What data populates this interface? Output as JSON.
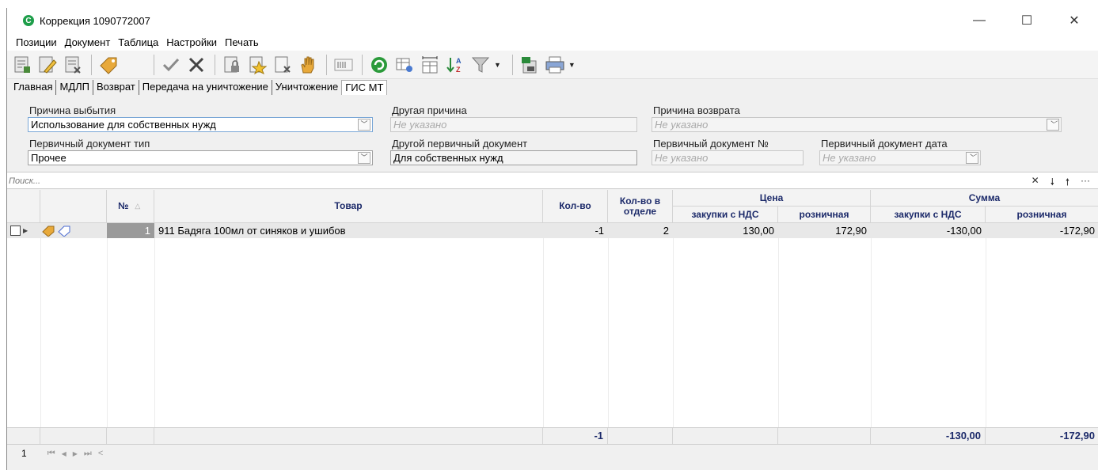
{
  "window": {
    "title": "Коррекция 1090772007",
    "icon_letter": "C",
    "controls": {
      "minimize": "—",
      "maximize": "☐",
      "close": "✕"
    }
  },
  "menu": [
    "Позиции",
    "Документ",
    "Таблица",
    "Настройки",
    "Печать"
  ],
  "toolbar": {
    "icons": [
      "add-row-icon",
      "edit-icon",
      "delete-row-icon",
      "tag-icon",
      "check-icon",
      "cancel-icon",
      "lock-doc-icon",
      "stamp-doc-icon",
      "doc-delete-icon",
      "stop-hand-icon",
      "barcode-icon",
      "refresh-icon",
      "table-settings-icon",
      "column-width-icon",
      "sort-az-icon",
      "filter-icon",
      "export-excel-icon",
      "print-icon"
    ]
  },
  "tabs": [
    "Главная",
    "МДЛП",
    "Возврат",
    "Передача на уничтожение",
    "Уничтожение",
    "ГИС МТ"
  ],
  "active_tab": "ГИС МТ",
  "form": {
    "reason_label": "Причина выбытия",
    "reason_value": "Использование для собственных нужд",
    "other_reason_label": "Другая причина",
    "other_reason_placeholder": "Не указано",
    "return_reason_label": "Причина возврата",
    "return_reason_placeholder": "Не указано",
    "doc_type_label": "Первичный документ тип",
    "doc_type_value": "Прочее",
    "other_doc_label": "Другой первичный документ",
    "other_doc_value": "Для собственных нужд",
    "doc_number_label": "Первичный документ №",
    "doc_number_placeholder": "Не указано",
    "doc_date_label": "Первичный документ дата",
    "doc_date_placeholder": "Не указано"
  },
  "search": {
    "placeholder": "Поиск...",
    "clear": "✕",
    "down": "🠗",
    "up": "🠕",
    "more": "···"
  },
  "grid": {
    "headers": {
      "num": "№",
      "product": "Товар",
      "qty": "Кол-во",
      "qty_dept": "Кол-во в отделе",
      "price_group": "Цена",
      "price_purchase": "закупки с НДС",
      "price_retail": "розничная",
      "sum_group": "Сумма",
      "sum_purchase": "закупки с НДС",
      "sum_retail": "розничная"
    },
    "rows": [
      {
        "num": "1",
        "product": "911 Бадяга 100мл от синяков и ушибов",
        "qty": "-1",
        "qty_dept": "2",
        "price_purchase": "130,00",
        "price_retail": "172,90",
        "sum_purchase": "-130,00",
        "sum_retail": "-172,90"
      }
    ],
    "totals": {
      "qty": "-1",
      "sum_purchase": "-130,00",
      "sum_retail": "-172,90"
    }
  },
  "nav": {
    "page": "1",
    "first": "⏮",
    "prev": "◀",
    "next": "▶",
    "last": "⏭",
    "back": "<"
  }
}
